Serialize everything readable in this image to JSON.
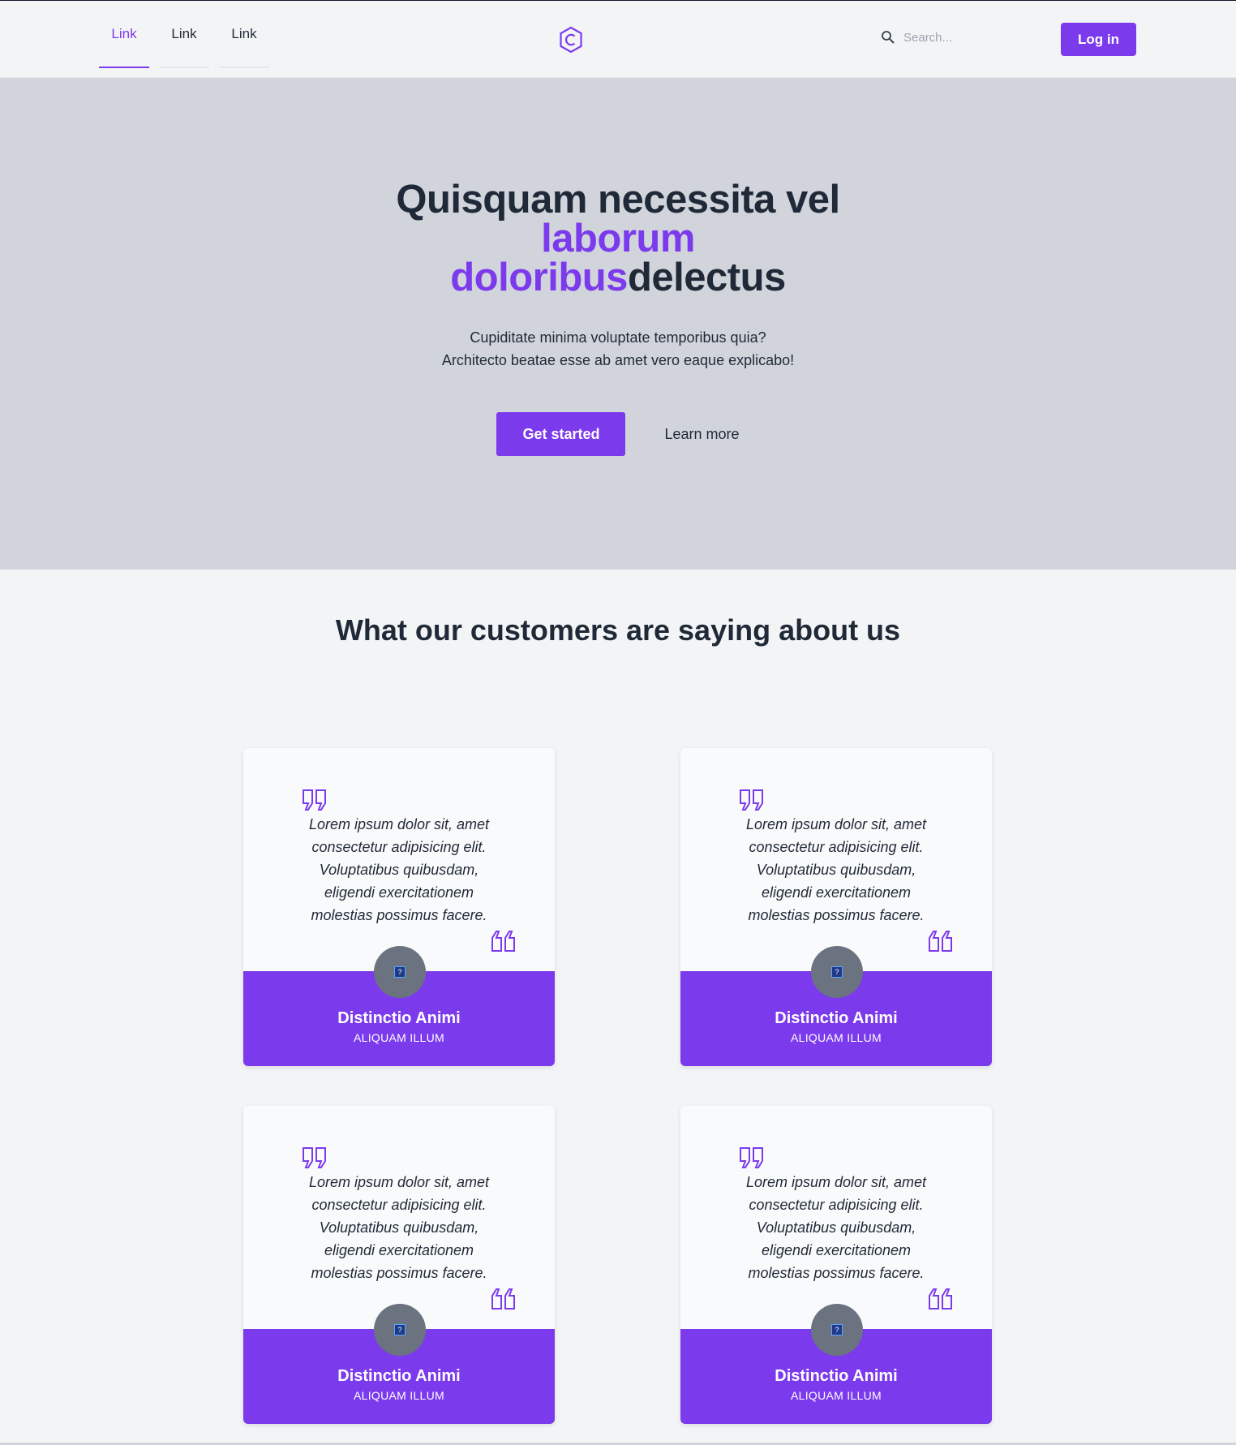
{
  "header": {
    "nav": [
      {
        "label": "Link",
        "active": true
      },
      {
        "label": "Link",
        "active": false
      },
      {
        "label": "Link",
        "active": false
      }
    ],
    "logo_icon": "hexagon-c-logo-icon",
    "search": {
      "placeholder": "Search...",
      "icon": "search-icon"
    },
    "login_label": "Log in"
  },
  "hero": {
    "title_part1": "Quisquam necessita vel ",
    "title_accent1": "laborum doloribus",
    "title_part2": "delectus",
    "subtitle_line1": "Cupiditate minima voluptate temporibus quia?",
    "subtitle_line2": "Architecto beatae esse ab amet vero eaque explicabo!",
    "primary_cta": "Get started",
    "secondary_cta": "Learn more"
  },
  "testimonials": {
    "title": "What our customers are saying about us",
    "items": [
      {
        "text": "Lorem ipsum dolor sit, amet consectetur adipisicing elit. Voluptatibus quibusdam, eligendi exercitationem molestias possimus facere.",
        "name": "Distinctio Animi",
        "role": "ALIQUAM ILLUM"
      },
      {
        "text": "Lorem ipsum dolor sit, amet consectetur adipisicing elit. Voluptatibus quibusdam, eligendi exercitationem molestias possimus facere.",
        "name": "Distinctio Animi",
        "role": "ALIQUAM ILLUM"
      },
      {
        "text": "Lorem ipsum dolor sit, amet consectetur adipisicing elit. Voluptatibus quibusdam, eligendi exercitationem molestias possimus facere.",
        "name": "Distinctio Animi",
        "role": "ALIQUAM ILLUM"
      },
      {
        "text": "Lorem ipsum dolor sit, amet consectetur adipisicing elit. Voluptatibus quibusdam, eligendi exercitationem molestias possimus facere.",
        "name": "Distinctio Animi",
        "role": "ALIQUAM ILLUM"
      }
    ]
  },
  "colors": {
    "accent": "#7c3aed",
    "hero_bg": "#d1d5db",
    "page_bg": "#f3f4f6",
    "text": "#1f2937"
  }
}
